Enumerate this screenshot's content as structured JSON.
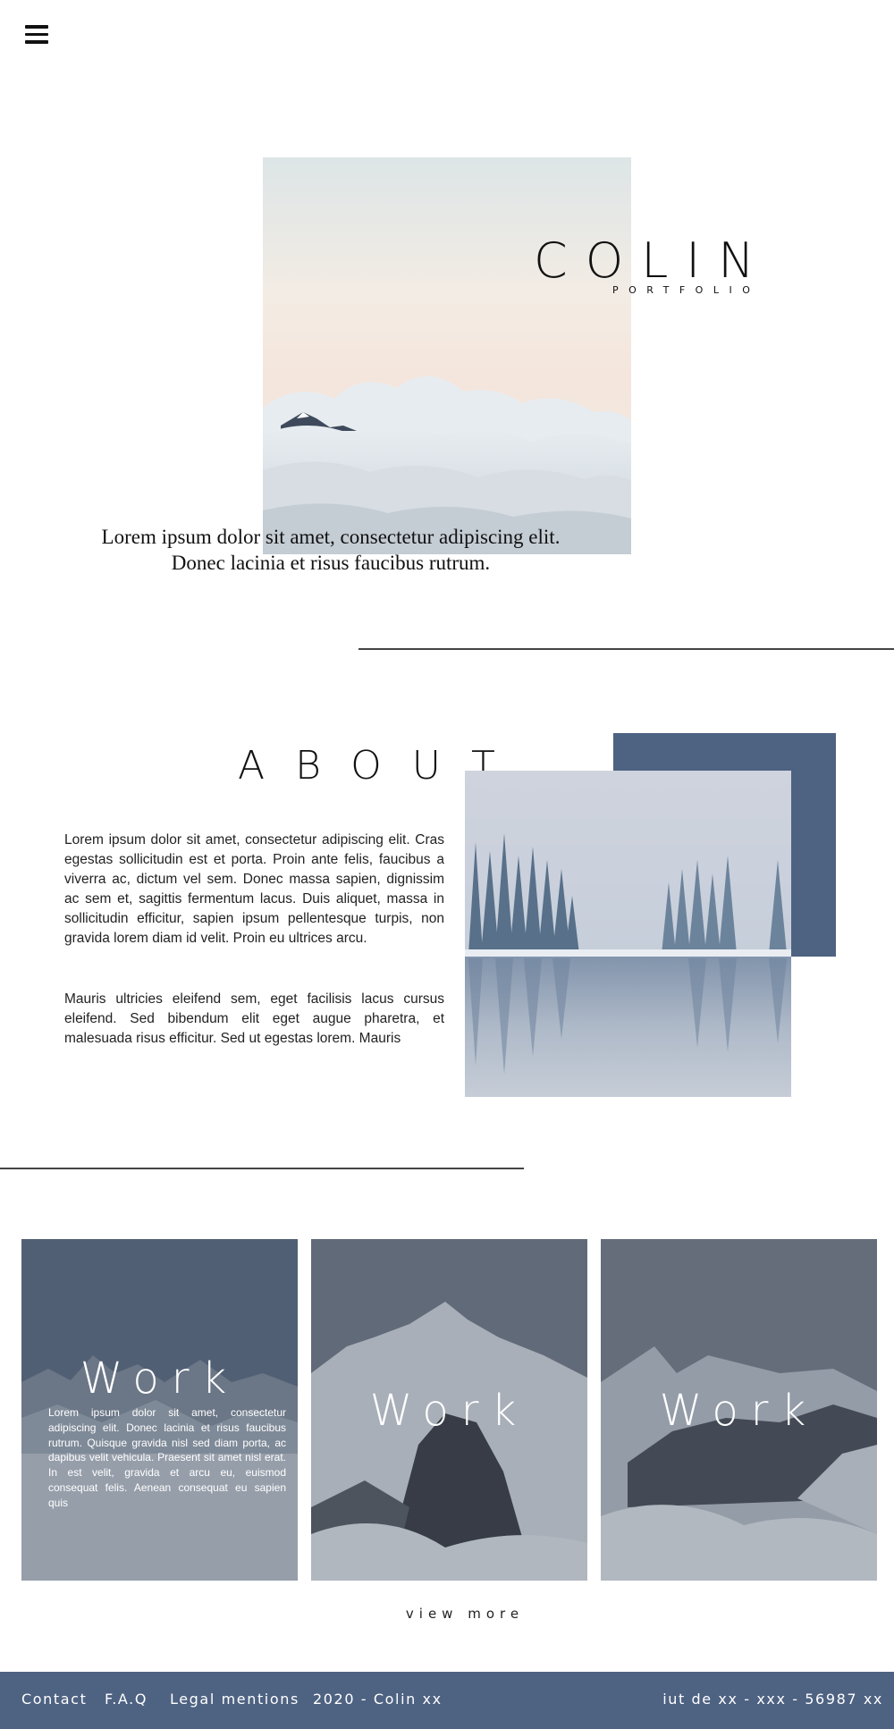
{
  "header": {
    "menu_icon": "hamburger-menu-icon"
  },
  "hero": {
    "title": "COLIN",
    "subtitle": "PORTFOLIO",
    "quote_line1": "Lorem ipsum dolor sit amet, consectetur adipiscing elit.",
    "quote_line2": "Donec lacinia et risus faucibus rutrum."
  },
  "about": {
    "title": "ABOUT",
    "paragraph1": "Lorem ipsum dolor sit amet, consectetur adipiscing elit. Cras egestas sollicitudin est et porta. Proin ante felis, faucibus a viverra ac, dictum vel sem. Donec massa sapien, dignissim ac sem et, sagittis fermentum lacus. Duis aliquet, massa in sollicitudin efficitur, sapien ipsum pellentesque turpis, non gravida lorem diam id velit. Proin eu ultrices arcu.",
    "paragraph2": "Mauris ultricies eleifend sem, eget facilisis lacus cursus eleifend. Sed bibendum elit eget augue pharetra, et malesuada risus efficitur. Sed ut egestas lorem. Mauris",
    "accent_color": "#4e6282"
  },
  "works": {
    "items": [
      {
        "label": "Work",
        "description": "Lorem ipsum dolor sit amet, consectetur adipiscing elit. Donec lacinia et risus faucibus rutrum. Quisque gravida nisl sed diam porta, ac dapibus velit vehicula. Praesent sit amet nisl erat. In est velit, gravida et arcu eu, euismod consequat felis. Aenean consequat eu sapien quis"
      },
      {
        "label": "Work"
      },
      {
        "label": "Work"
      }
    ],
    "view_more": "view more"
  },
  "footer": {
    "links": [
      "Contact",
      "F.A.Q",
      "Legal mentions"
    ],
    "year": "2020 - Colin xx",
    "address": "iut de xx - xxx - 56987 xx",
    "background": "#4e6282"
  }
}
